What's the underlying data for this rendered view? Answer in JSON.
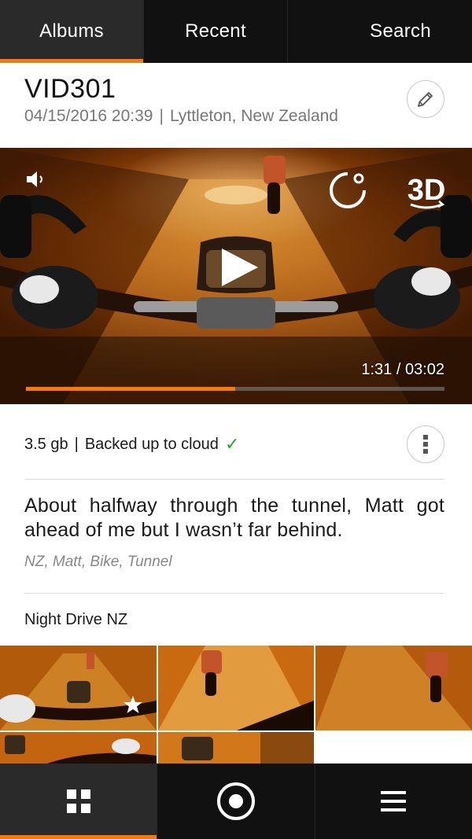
{
  "tabs": [
    {
      "label": "Albums",
      "active": true
    },
    {
      "label": "Recent",
      "active": false
    },
    {
      "label": "Search",
      "active": false
    }
  ],
  "item": {
    "title": "VID301",
    "date": "04/15/2016 20:39",
    "location": "Lyttleton, New Zealand",
    "separator": "|"
  },
  "video": {
    "timecode": "1:31 / 03:02",
    "progress": 0.5,
    "icons": [
      "volume-icon",
      "rotate-icon",
      "3d-icon",
      "play-icon"
    ],
    "badge_3d": "3D"
  },
  "info": {
    "size": "3.5 gb",
    "status": "Backed up to cloud",
    "check": "✓"
  },
  "description": "About halfway through the tunnel, Matt got ahead of me but I wasn’t far behind.",
  "tags": "NZ, Matt, Bike, Tunnel",
  "album": {
    "name": "Night Drive NZ"
  },
  "bottom_nav": [
    {
      "icon": "grid-icon",
      "active": true
    },
    {
      "icon": "record-icon",
      "active": false
    },
    {
      "icon": "menu-icon",
      "active": false
    }
  ],
  "colors": {
    "accent": "#f47a0f",
    "bar": "#111111",
    "check": "#2aa52a"
  }
}
